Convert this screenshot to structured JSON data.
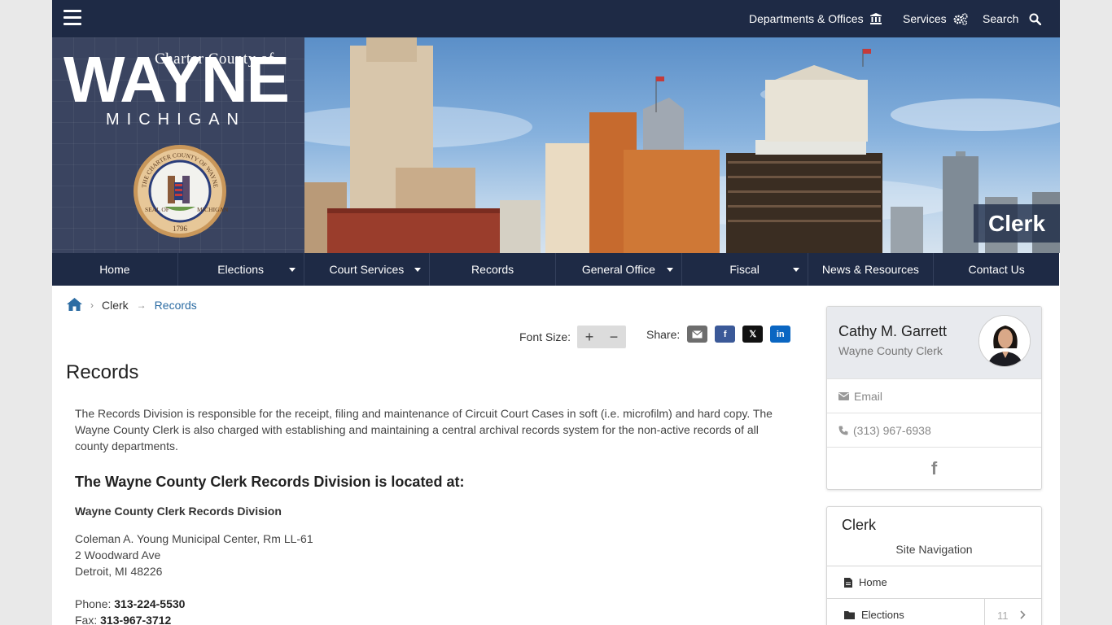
{
  "header": {
    "utility_links": [
      {
        "label": "Departments & Offices",
        "icon": "institution-icon"
      },
      {
        "label": "Services",
        "icon": "gears-icon"
      },
      {
        "label": "Search",
        "icon": "search-icon"
      }
    ]
  },
  "banner": {
    "logo_charter": "Charter County of",
    "logo_wayne": "WAYNE",
    "logo_michigan": "MICHIGAN",
    "seal_top": "THE CHARTER COUNTY OF WAYNE",
    "seal_left": "SEAL OF",
    "seal_right": "MICHIGAN",
    "seal_year": "1796",
    "department": "Clerk"
  },
  "nav": {
    "items": [
      {
        "label": "Home",
        "dropdown": false
      },
      {
        "label": "Elections",
        "dropdown": true
      },
      {
        "label": "Court Services",
        "dropdown": true
      },
      {
        "label": "Records",
        "dropdown": false
      },
      {
        "label": "General Office",
        "dropdown": true
      },
      {
        "label": "Fiscal",
        "dropdown": true
      },
      {
        "label": "News & Resources",
        "dropdown": false
      },
      {
        "label": "Contact Us",
        "dropdown": false
      }
    ]
  },
  "breadcrumb": {
    "parent": "Clerk",
    "current": "Records"
  },
  "tools": {
    "font_size_label": "Font Size:",
    "font_plus": "+",
    "font_minus": "−",
    "share_label": "Share:",
    "share_buttons": [
      {
        "name": "email",
        "color": "#6d6d6d"
      },
      {
        "name": "facebook",
        "color": "#3b5998",
        "text": "f"
      },
      {
        "name": "x",
        "color": "#111111",
        "text": "𝕏"
      },
      {
        "name": "linkedin",
        "color": "#0a66c2",
        "text": "in"
      }
    ]
  },
  "main": {
    "title": "Records",
    "intro": "The Records Division is responsible for the receipt, filing and maintenance of Circuit Court Cases in soft (i.e. microfilm) and hard copy. The Wayne County Clerk is also charged with establishing and maintaining a central archival records system for the non-active records of all county departments.",
    "location_heading": "The Wayne County Clerk Records Division is located at:",
    "division_name": "Wayne County Clerk Records Division",
    "address": [
      "Coleman A. Young Municipal Center, Rm LL-61",
      "2 Woodward Ave",
      "Detroit, MI 48226"
    ],
    "phone_label": "Phone:",
    "phone": "313-224-5530",
    "fax_label": "Fax:",
    "fax": "313-967-3712"
  },
  "sidebar": {
    "contact": {
      "name": "Cathy M. Garrett",
      "role": "Wayne County Clerk",
      "email_label": "Email",
      "phone": "(313) 967-6938",
      "facebook": "f"
    },
    "site_nav": {
      "title": "Clerk",
      "subtitle": "Site Navigation",
      "items": [
        {
          "label": "Home",
          "icon": "document-icon"
        },
        {
          "label": "Elections",
          "icon": "folder-icon",
          "count": "11"
        }
      ]
    }
  },
  "colors": {
    "navy": "#1e2a45",
    "link": "#2c6ca3",
    "page_bg": "#e9e9e9"
  }
}
